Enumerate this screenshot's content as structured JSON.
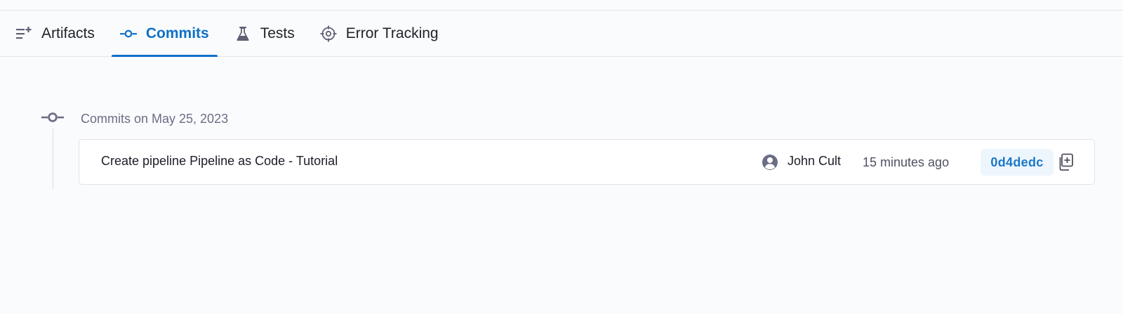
{
  "tabs": [
    {
      "label": "Artifacts",
      "icon": "list-add-icon",
      "active": false
    },
    {
      "label": "Commits",
      "icon": "git-commit-icon",
      "active": true
    },
    {
      "label": "Tests",
      "icon": "flask-icon",
      "active": false
    },
    {
      "label": "Error Tracking",
      "icon": "target-icon",
      "active": false
    }
  ],
  "commits": {
    "group_label": "Commits on May 25, 2023",
    "items": [
      {
        "message": "Create pipeline Pipeline as Code - Tutorial",
        "author": "John Cult",
        "time": "15 minutes ago",
        "sha": "0d4dedc"
      }
    ]
  },
  "colors": {
    "accent": "#0f70c8",
    "sha_bg": "#eef6fd",
    "background": "#fafbfd"
  }
}
